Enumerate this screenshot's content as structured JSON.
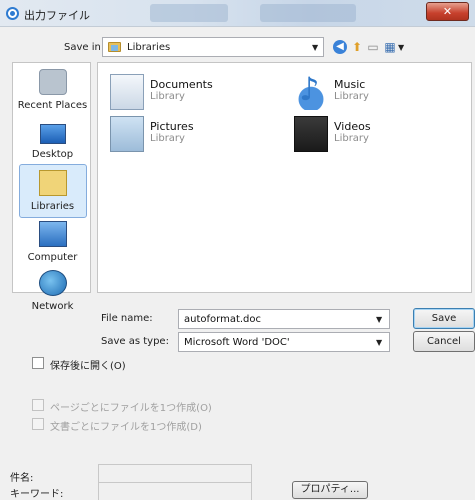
{
  "window": {
    "title": "出力ファイル",
    "close_label": "✕"
  },
  "toolbar": {
    "save_in_label": "Save in:",
    "save_in_value": "Libraries",
    "icons": [
      "back-icon",
      "up-folder-icon",
      "new-folder-icon",
      "views-menu-icon"
    ]
  },
  "places": [
    {
      "label": "Recent Places",
      "icon": "recent-places-icon"
    },
    {
      "label": "Desktop",
      "icon": "desktop-icon"
    },
    {
      "label": "Libraries",
      "icon": "libraries-icon",
      "selected": true
    },
    {
      "label": "Computer",
      "icon": "computer-icon"
    },
    {
      "label": "Network",
      "icon": "network-icon"
    }
  ],
  "files": [
    {
      "name": "Documents",
      "type": "Library",
      "icon": "documents-library-icon"
    },
    {
      "name": "Music",
      "type": "Library",
      "icon": "music-library-icon"
    },
    {
      "name": "Pictures",
      "type": "Library",
      "icon": "pictures-library-icon"
    },
    {
      "name": "Videos",
      "type": "Library",
      "icon": "videos-library-icon"
    }
  ],
  "form": {
    "file_name_label": "File name:",
    "file_name_value": "autoformat.doc",
    "save_type_label": "Save as type:",
    "save_type_value": "Microsoft Word 'DOC'",
    "save_button": "Save",
    "cancel_button": "Cancel"
  },
  "options": {
    "open_after_save": "保存後に開く(O)",
    "file_per_page": "ページごとにファイルを1つ作成(O)",
    "file_per_document": "文書ごとにファイルを1つ作成(D)"
  },
  "meta": {
    "subject_label": "件名:",
    "keywords_label": "キーワード:",
    "properties_button": "プロパティ..."
  },
  "colors": {
    "selection": "#d9ebfb",
    "selection_border": "#84acdd",
    "close_button": "#c7402c",
    "dialog_bg": "#f0f0f0"
  }
}
